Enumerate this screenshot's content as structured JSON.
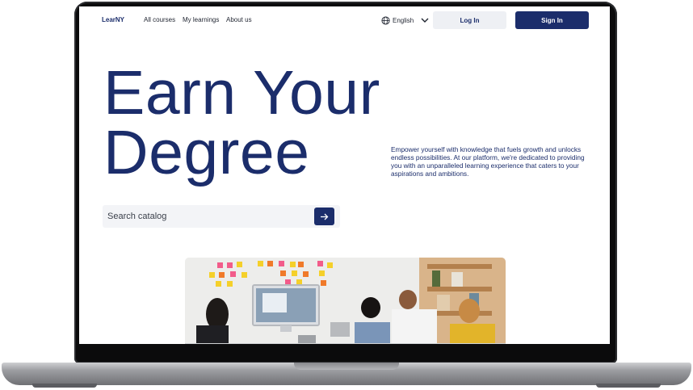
{
  "brand": {
    "logo": "LearNY"
  },
  "nav": {
    "links": [
      "All courses",
      "My learnings",
      "About us"
    ],
    "language": "English",
    "login_label": "Log In",
    "signin_label": "Sign In"
  },
  "hero": {
    "title_line1": "Earn Your",
    "title_line2": "Degree",
    "description": "Empower yourself with knowledge that fuels growth and unlocks endless possibilities. At our platform, we're dedicated to providing you with an unparalleled learning experience that caters to your aspirations and ambitions."
  },
  "search": {
    "placeholder": "Search catalog"
  },
  "colors": {
    "primary": "#1b2d6b",
    "login_bg": "#eef0f4",
    "search_bg": "#f3f4f7"
  },
  "icons": {
    "language": "globe-icon",
    "dropdown": "chevron-down-icon",
    "search_submit": "arrow-right-icon"
  }
}
